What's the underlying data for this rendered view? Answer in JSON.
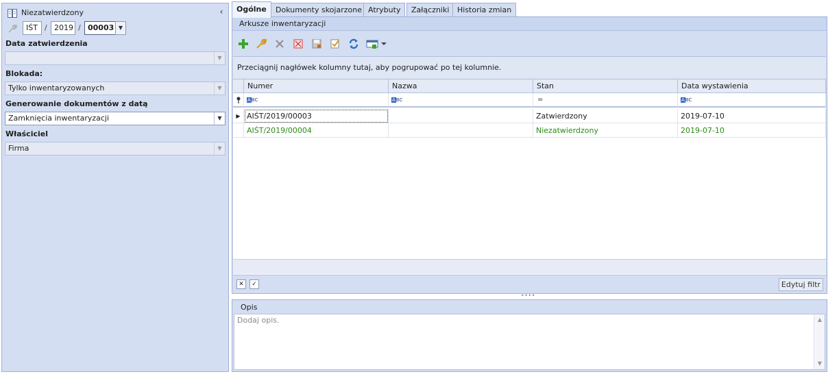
{
  "header": {
    "status_text": "Niezatwierdzony",
    "number": {
      "series": "IŚT",
      "separator": "/",
      "year": "2019",
      "no": "00003"
    }
  },
  "form": {
    "approval_date": {
      "label": "Data zatwierdzenia",
      "value": ""
    },
    "blockade": {
      "label": "Blokada:",
      "value": "Tylko inwentaryzowanych"
    },
    "doc_gen": {
      "label": "Generowanie dokumentów z datą",
      "value": "Zamknięcia inwentaryzacji"
    },
    "owner": {
      "label": "Właściciel",
      "value": "Firma"
    }
  },
  "tabs": [
    {
      "label": "Ogólne"
    },
    {
      "label": "Dokumenty skojarzone"
    },
    {
      "label": "Atrybuty"
    },
    {
      "label": "Załączniki"
    },
    {
      "label": "Historia zmian"
    }
  ],
  "sheets": {
    "title": "Arkusze inwentaryzacji",
    "group_hint": "Przeciągnij nagłówek kolumny tutaj, aby pogrupować po tej kolumnie.",
    "columns": [
      "Numer",
      "Nazwa",
      "Stan",
      "Data wystawienia"
    ],
    "filter_icons": [
      "abc",
      "abc",
      "=",
      "abc"
    ],
    "rows": [
      {
        "numer": "AIŚT/2019/00003",
        "nazwa": "",
        "stan": "Zatwierdzony",
        "data": "2019-07-10"
      },
      {
        "numer": "AIŚT/2019/00004",
        "nazwa": "",
        "stan": "Niezatwierdzony",
        "data": "2019-07-10"
      }
    ],
    "edit_filter_label": "Edytuj filtr",
    "toolbar": [
      "add-icon",
      "edit-icon",
      "delete-icon",
      "cancel-icon",
      "save-icon",
      "approve-icon",
      "refresh-icon",
      "export-icon"
    ]
  },
  "opis": {
    "title": "Opis",
    "placeholder": "Dodaj opis."
  },
  "colors": {
    "panel": "#d4def2",
    "approved_green": "#2c8a17",
    "add_green": "#3aa52b"
  }
}
